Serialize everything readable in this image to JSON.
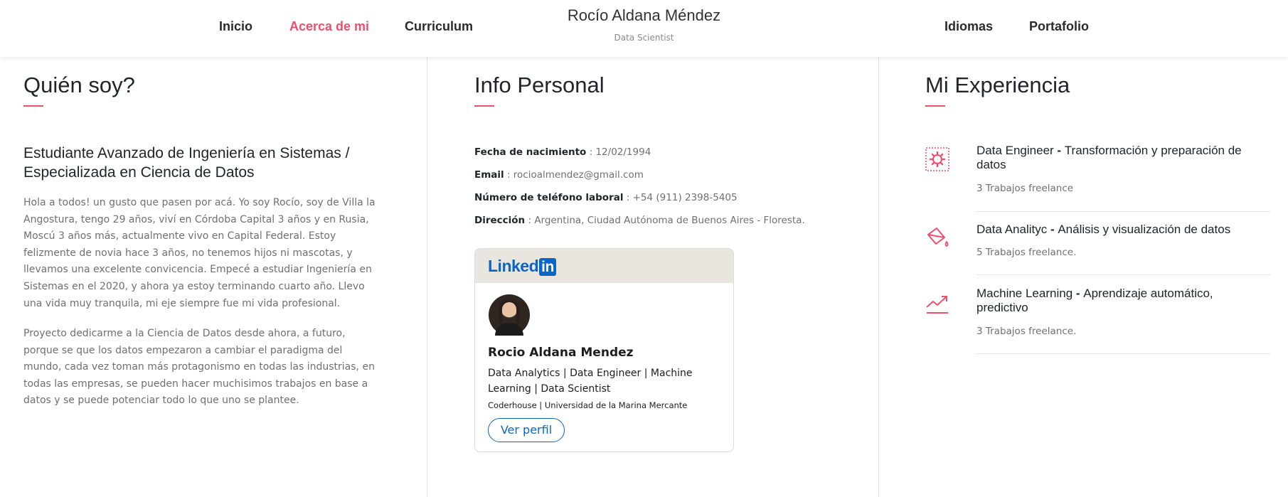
{
  "header": {
    "nav_left": [
      "Inicio",
      "Acerca de mi",
      "Curriculum"
    ],
    "nav_right": [
      "Idiomas",
      "Portafolio"
    ],
    "brand_name": "Rocío Aldana Méndez",
    "brand_subtitle": "Data Scientist"
  },
  "about": {
    "title": "Quién soy?",
    "subtitle": "Estudiante Avanzado de Ingeniería en Sistemas / Especializada en Ciencia de Datos",
    "paragraph1": "Hola a todos! un gusto que pasen por acá. Yo soy Rocío, soy de Villa la Angostura, tengo 29 años, viví en Córdoba Capital 3 años y en Rusia, Moscú 3 años más, actualmente vivo en Capital Federal. Estoy felizmente de novia hace 3 años, no tenemos hijos ni mascotas, y llevamos una excelente convicencia. Empecé a estudiar Ingeniería en Sistemas en el 2020, y ahora ya estoy terminando cuarto año. Llevo una vida muy tranquila, mi eje siempre fue mi vida profesional.",
    "paragraph2": "Proyecto dedicarme a la Ciencia de Datos desde ahora, a futuro, porque se que los datos empezaron a cambiar el paradigma del mundo, cada vez toman más protagonismo en todas las industrias, en todas las empresas, se pueden hacer muchisimos trabajos en base a datos y se puede potenciar todo lo que uno se plantee."
  },
  "info": {
    "title": "Info Personal",
    "rows": [
      {
        "label": "Fecha de nacimiento",
        "value": "12/02/1994"
      },
      {
        "label": "Email",
        "value": "rocioalmendez@gmail.com"
      },
      {
        "label": "Número de teléfono laboral",
        "value": "+54 (911) 2398-5405"
      },
      {
        "label": "Dirección",
        "value": "Argentina, Ciudad Autónoma de Buenos Aires - Floresta."
      }
    ],
    "separator": " : "
  },
  "linkedin": {
    "logo_text": "Linked",
    "logo_in": "in",
    "name": "Rocio Aldana Mendez",
    "headline": "Data Analytics | Data Engineer | Machine Learning | Data Scientist",
    "education": "Coderhouse | Universidad de la Marina Mercante",
    "button_label": "Ver perfil"
  },
  "experience": {
    "title": "Mi Experiencia",
    "items": [
      {
        "role": "Data Engineer",
        "dash": " - ",
        "desc": "Transformación y preparación de datos",
        "sub": "3 Trabajos freelance",
        "icon": "gear-icon"
      },
      {
        "role": "Data Analityc",
        "dash": " - ",
        "desc": "Análisis y visualización de datos",
        "sub": "5 Trabajos freelance.",
        "icon": "paint-bucket-icon"
      },
      {
        "role": "Machine Learning",
        "dash": " - ",
        "desc": "Aprendizaje automático, predictivo",
        "sub": "3 Trabajos freelance.",
        "icon": "trending-up-icon"
      }
    ]
  },
  "colors": {
    "accent": "#ef4f6b",
    "linkedin_blue": "#0a66c2"
  }
}
